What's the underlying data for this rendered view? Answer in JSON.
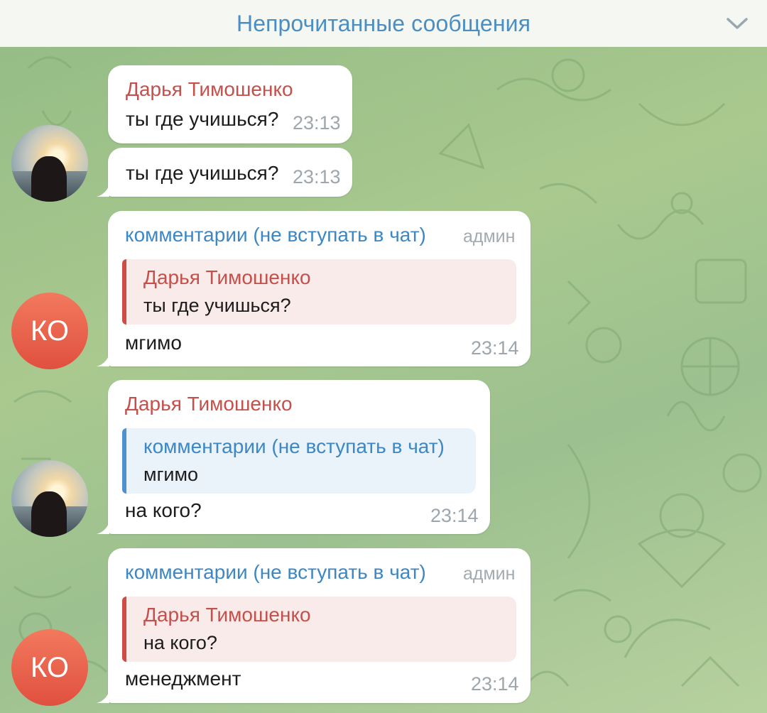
{
  "header": {
    "title": "Непрочитанные сообщения"
  },
  "messages": [
    {
      "sender": "Дарья Тимошенко",
      "text": "ты где учишься?",
      "time": "23:13"
    },
    {
      "text": "ты где учишься?",
      "time": "23:13"
    },
    {
      "sender": "комментарии (не вступать в чат)",
      "role": "админ",
      "reply": {
        "sender": "Дарья Тимошенко",
        "text": "ты где учишься?"
      },
      "text": "мгимо",
      "time": "23:14",
      "avatar_initials": "КО"
    },
    {
      "sender": "Дарья Тимошенко",
      "reply": {
        "sender": "комментарии (не вступать в чат)",
        "text": "мгимо"
      },
      "text": "на кого?",
      "time": "23:14"
    },
    {
      "sender": "комментарии (не вступать в чат)",
      "role": "админ",
      "reply": {
        "sender": "Дарья Тимошенко",
        "text": "на кого?"
      },
      "text": "менеджмент",
      "time": "23:14",
      "avatar_initials": "КО"
    }
  ],
  "colors": {
    "header_title": "#4a8ec2",
    "sender_red": "#c5504b",
    "sender_blue": "#3d87c4",
    "avatar_ko": "#e8604a",
    "chat_background": "#a3c58e"
  },
  "icons": {
    "header_chevron": "chevron-down-icon"
  }
}
